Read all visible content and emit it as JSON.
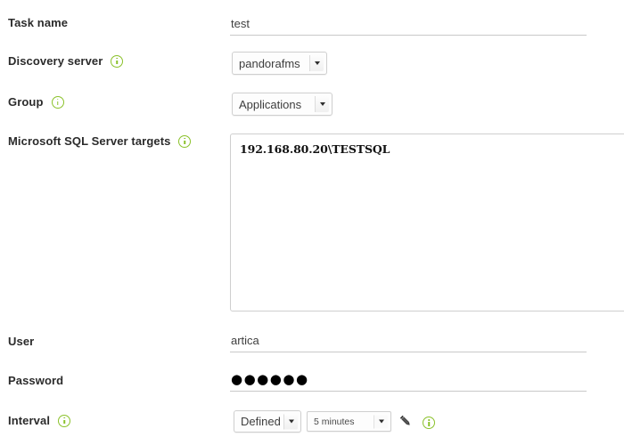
{
  "form": {
    "rows": [
      {
        "label": "Task name",
        "has_info": false,
        "control": "text-input",
        "value": "test",
        "placeholder": ""
      },
      {
        "label": "Discovery server",
        "has_info": true,
        "control": "select",
        "value": "pandorafms"
      },
      {
        "label": "Group",
        "has_info": true,
        "control": "select",
        "value": "Applications"
      },
      {
        "label": "Microsoft SQL Server targets",
        "has_info": true,
        "control": "textarea",
        "value": "192.168.80.20\\TESTSQL",
        "placeholder": ""
      },
      {
        "label": "User",
        "has_info": false,
        "control": "text-input",
        "value": "artica",
        "placeholder": ""
      },
      {
        "label": "Password",
        "has_info": false,
        "control": "password-input",
        "value": "●●●●●●",
        "placeholder": ""
      },
      {
        "label": "Interval",
        "has_info": true,
        "control": "interval",
        "mode_value": "Defined",
        "amount_value": "5 minutes"
      }
    ],
    "icons": {
      "info": "info-icon",
      "pencil": "pencil-edit-icon",
      "dropdown_arrow": "chevron-down-icon"
    },
    "colors": {
      "info_green": "#8ac12a",
      "label_text": "#2b2b2b",
      "field_underline": "#c9c9c9",
      "field_border": "#cfcfcf",
      "background": "#ffffff"
    }
  }
}
